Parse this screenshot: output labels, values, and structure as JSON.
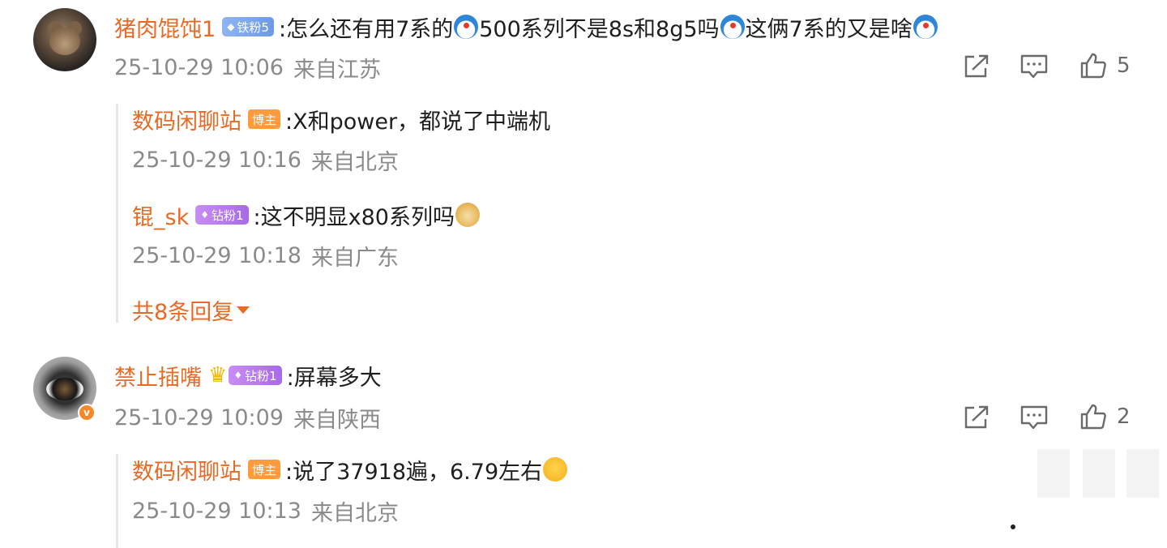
{
  "comments": [
    {
      "username": "猪肉馄饨1",
      "badge": "铁粉5",
      "text_parts": [
        ":怎么还有用7系的",
        "500系列不是8s和8g5吗",
        "这俩7系的又是啥"
      ],
      "emoji": "doraemon-emoji",
      "timestamp": "25-10-29 10:06",
      "location": "来自江苏",
      "like_count": "5",
      "replies": [
        {
          "username": "数码闲聊站",
          "badge": "博主",
          "text": ":X和power，都说了中端机",
          "timestamp": "25-10-29 10:16",
          "location": "来自北京"
        },
        {
          "username": "锟_sk",
          "badge": "钻粉1",
          "text": ":这不明显x80系列吗",
          "emoji": "doge-emoji",
          "timestamp": "25-10-29 10:18",
          "location": "来自广东"
        }
      ],
      "more_replies": "共8条回复"
    },
    {
      "username": "禁止插嘴",
      "badge": "钻粉1",
      "text": ":屏幕多大",
      "verified_icon": "v",
      "timestamp": "25-10-29 10:09",
      "location": "来自陕西",
      "like_count": "2",
      "replies": [
        {
          "username": "数码闲聊站",
          "badge": "博主",
          "text": ":说了37918遍，6.79左右",
          "emoji": "hug-emoji",
          "timestamp": "25-10-29 10:13",
          "location": "来自北京"
        }
      ]
    }
  ],
  "icons": {
    "share": "share-icon",
    "comment": "comment-icon",
    "like": "thumbs-up-icon"
  },
  "colors": {
    "username": "#e86a24",
    "meta": "#8a8a8a",
    "text": "#1e1e1e",
    "host_badge": "#ff9a3d",
    "iron_badge": "#6b9be6",
    "diamond_badge": "#a86ae8"
  }
}
